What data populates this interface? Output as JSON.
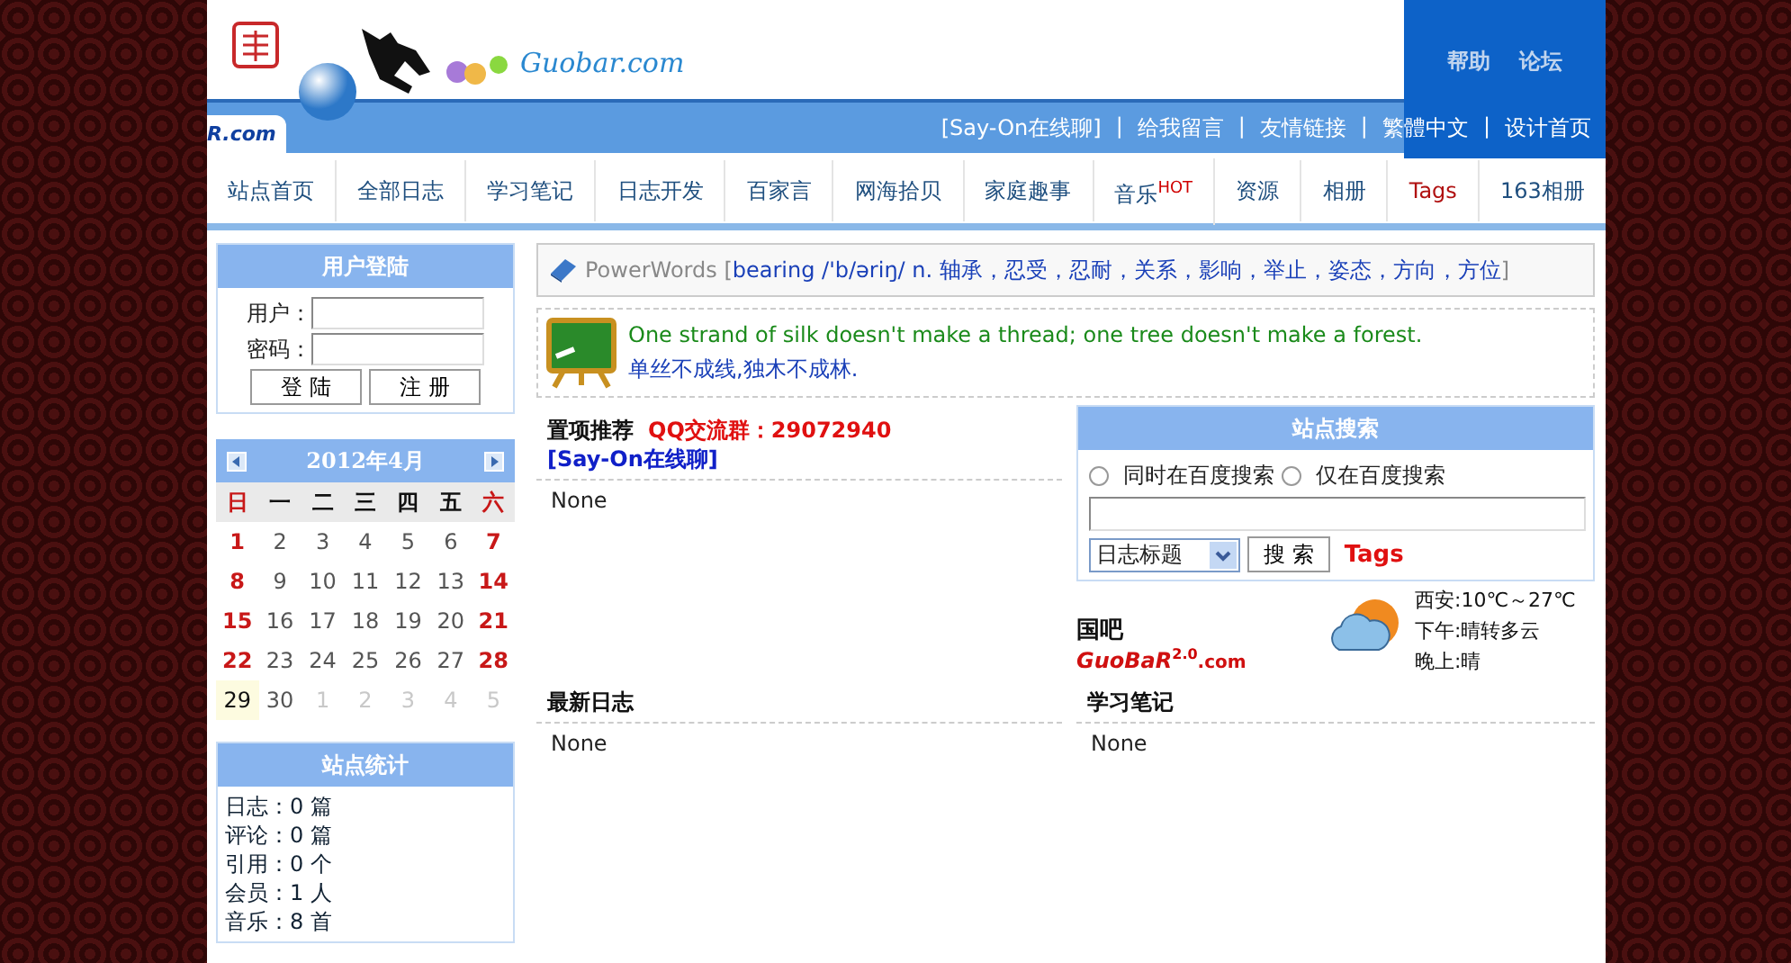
{
  "header": {
    "logo_text": "Guobar.com",
    "logo_fragment": "R.com",
    "top_links": [
      "帮助",
      "论坛"
    ],
    "bar_links": [
      "[Say-On在线聊]",
      "给我留言",
      "友情链接",
      "繁體中文",
      "设计首页"
    ],
    "separator": "|"
  },
  "nav": [
    {
      "label": "站点首页",
      "kind": "normal"
    },
    {
      "label": "全部日志",
      "kind": "normal"
    },
    {
      "label": "学习笔记",
      "kind": "normal"
    },
    {
      "label": "日志开发",
      "kind": "normal"
    },
    {
      "label": "百家言",
      "kind": "normal"
    },
    {
      "label": "网海拾贝",
      "kind": "normal"
    },
    {
      "label": "家庭趣事",
      "kind": "normal"
    },
    {
      "label": "音乐",
      "kind": "hot",
      "badge": "HOT"
    },
    {
      "label": "资源",
      "kind": "normal"
    },
    {
      "label": "相册",
      "kind": "normal"
    },
    {
      "label": "Tags",
      "kind": "tag"
    },
    {
      "label": "163相册",
      "kind": "normal"
    }
  ],
  "login": {
    "title": "用户登陆",
    "fields": [
      {
        "label": "用户："
      },
      {
        "label": "密码："
      }
    ],
    "buttons": [
      "登 陆",
      "注 册"
    ]
  },
  "calendar": {
    "title": "2012年4月",
    "weekdays": [
      {
        "label": "日",
        "kind": "weekend"
      },
      {
        "label": "一",
        "kind": "weekday"
      },
      {
        "label": "二",
        "kind": "weekday"
      },
      {
        "label": "三",
        "kind": "weekday"
      },
      {
        "label": "四",
        "kind": "weekday"
      },
      {
        "label": "五",
        "kind": "weekday"
      },
      {
        "label": "六",
        "kind": "weekend"
      }
    ],
    "days": [
      {
        "label": "1",
        "kind": "weekend",
        "selected": false
      },
      {
        "label": "2",
        "kind": "weekday",
        "selected": false
      },
      {
        "label": "3",
        "kind": "weekday",
        "selected": false
      },
      {
        "label": "4",
        "kind": "weekday",
        "selected": false
      },
      {
        "label": "5",
        "kind": "weekday",
        "selected": false
      },
      {
        "label": "6",
        "kind": "weekday",
        "selected": false
      },
      {
        "label": "7",
        "kind": "weekend",
        "selected": false
      },
      {
        "label": "8",
        "kind": "weekend",
        "selected": false
      },
      {
        "label": "9",
        "kind": "weekday",
        "selected": false
      },
      {
        "label": "10",
        "kind": "weekday",
        "selected": false
      },
      {
        "label": "11",
        "kind": "weekday",
        "selected": false
      },
      {
        "label": "12",
        "kind": "weekday",
        "selected": false
      },
      {
        "label": "13",
        "kind": "weekday",
        "selected": false
      },
      {
        "label": "14",
        "kind": "weekend",
        "selected": false
      },
      {
        "label": "15",
        "kind": "weekend",
        "selected": false
      },
      {
        "label": "16",
        "kind": "weekday",
        "selected": false
      },
      {
        "label": "17",
        "kind": "weekday",
        "selected": false
      },
      {
        "label": "18",
        "kind": "weekday",
        "selected": false
      },
      {
        "label": "19",
        "kind": "weekday",
        "selected": false
      },
      {
        "label": "20",
        "kind": "weekday",
        "selected": false
      },
      {
        "label": "21",
        "kind": "weekend",
        "selected": false
      },
      {
        "label": "22",
        "kind": "weekend",
        "selected": false
      },
      {
        "label": "23",
        "kind": "weekday",
        "selected": false
      },
      {
        "label": "24",
        "kind": "weekday",
        "selected": false
      },
      {
        "label": "25",
        "kind": "weekday",
        "selected": false
      },
      {
        "label": "26",
        "kind": "weekday",
        "selected": false
      },
      {
        "label": "27",
        "kind": "weekday",
        "selected": false
      },
      {
        "label": "28",
        "kind": "weekend",
        "selected": false
      },
      {
        "label": "29",
        "kind": "weekday",
        "selected": true
      },
      {
        "label": "30",
        "kind": "weekday",
        "selected": false
      },
      {
        "label": "1",
        "kind": "other",
        "selected": false
      },
      {
        "label": "2",
        "kind": "other",
        "selected": false
      },
      {
        "label": "3",
        "kind": "other",
        "selected": false
      },
      {
        "label": "4",
        "kind": "other",
        "selected": false
      },
      {
        "label": "5",
        "kind": "other",
        "selected": false
      }
    ]
  },
  "stats": {
    "title": "站点统计",
    "lines": [
      "日志：0 篇",
      "评论：0 篇",
      "引用：0 个",
      "会员：1 人",
      "音乐：8 首"
    ]
  },
  "powerwords": {
    "label": "PowerWords",
    "open": "[",
    "entry": "bearing /'b/əriŋ/ n. 轴承，忍受，忍耐，关系，影响，举止，姿态，方向，方位",
    "close": "]"
  },
  "proverb": {
    "english": "One strand of silk doesn't make a thread; one tree doesn't make a forest.",
    "chinese": "单丝不成线,独木不成林."
  },
  "featured": {
    "title": "置项推荐",
    "qq": "QQ交流群：29072940",
    "link": "[Say-On在线聊]",
    "body": "None"
  },
  "search": {
    "title": "站点搜索",
    "radios": [
      {
        "label": "同时在百度搜索",
        "selected": false
      },
      {
        "label": "仅在百度搜索",
        "selected": false
      }
    ],
    "select": "日志标题",
    "button": "搜 索",
    "tags": "Tags"
  },
  "guobar": {
    "name": "国吧",
    "brand": "GuoBaR",
    "version": "2.0",
    "domain": ".com"
  },
  "weather": {
    "lines": [
      "西安:10℃～27℃",
      "下午:晴转多云",
      "晚上:晴"
    ]
  },
  "sections": [
    {
      "title": "最新日志",
      "body": "None"
    },
    {
      "title": "学习笔记",
      "body": "None"
    }
  ]
}
